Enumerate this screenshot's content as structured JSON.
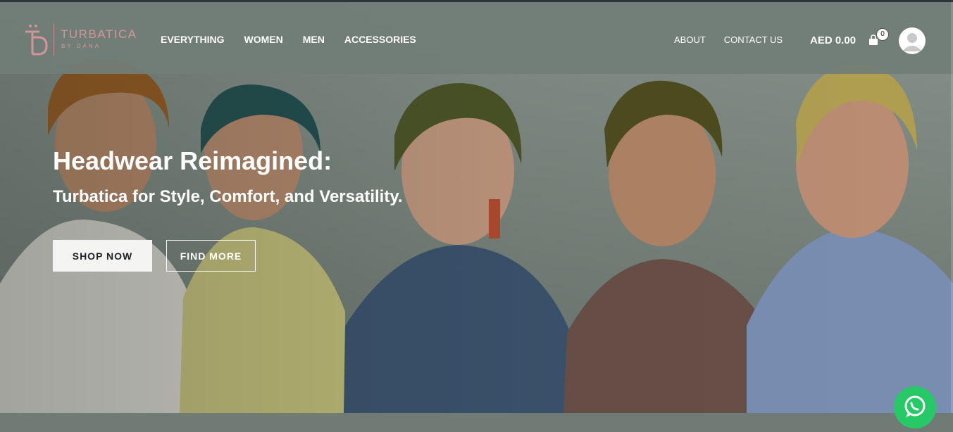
{
  "brand": {
    "name": "TURBATICA",
    "tagline": "BY DANA"
  },
  "nav": {
    "main": [
      "EVERYTHING",
      "WOMEN",
      "MEN",
      "ACCESSORIES"
    ],
    "secondary": [
      "ABOUT",
      "CONTACT US"
    ]
  },
  "cart": {
    "total": "AED 0.00",
    "count": "0"
  },
  "hero": {
    "title": "Headwear Reimagined:",
    "subtitle": "Turbatica for Style, Comfort, and Versatility.",
    "primary_button": "SHOP NOW",
    "secondary_button": "FIND MORE"
  },
  "icons": {
    "logo": "turbatica-monogram-icon",
    "cart": "shopping-bag-icon",
    "account": "user-avatar-icon",
    "chat": "whatsapp-icon"
  },
  "colors": {
    "header_bg": "#717e77",
    "logo": "#d4959a",
    "primary_button_bg": "#f4f4f2",
    "whatsapp": "#27c966"
  }
}
